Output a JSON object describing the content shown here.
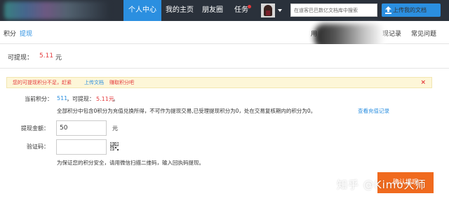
{
  "nav": {
    "items": [
      {
        "label": "个人中心",
        "active": true
      },
      {
        "label": "我的主页",
        "active": false
      },
      {
        "label": "朋友圈",
        "active": false
      },
      {
        "label": "任务",
        "active": false
      }
    ],
    "search_placeholder": "在道客巴巴数亿文档库中搜索",
    "upload_label": "上传我的文档",
    "accent_color": "#2b8fe0",
    "bar_color": "#2a313b"
  },
  "subnav": {
    "crumb_primary": "积分",
    "crumb_secondary": "提现",
    "tab_left": "用",
    "tab_record": "现记录",
    "tab_faq": "常见问题"
  },
  "balance": {
    "label": "可提现：",
    "value": "5.11",
    "unit": "元"
  },
  "notice": {
    "text": "您的可提现积分不足，赶紧",
    "link_upload": "上传文档",
    "link_earn": "赚取积分吧",
    "close": "×"
  },
  "form": {
    "points_label": "当前积分：",
    "points_value": "511",
    "withdrawable_label": "，可提现：",
    "withdrawable_value": "5.11元",
    "withdrawable_suffix": "。",
    "points_note": "全部积分中包含0积分为充值兑换所得，不可作为提现交易,已受理提现积分为0，处在交易复核期内的积分为0。",
    "recharge_link": "查看充值记录",
    "amount_label": "提现金额：",
    "amount_value": "50",
    "amount_unit": "元",
    "captcha_label": "验证码：",
    "captcha_value": "",
    "security_note": "为保证您的积分安全，请用微信扫描二维码，输入回执码提现。",
    "submit_label": "确认提现"
  },
  "watermark": "知乎 @Kimo大师"
}
